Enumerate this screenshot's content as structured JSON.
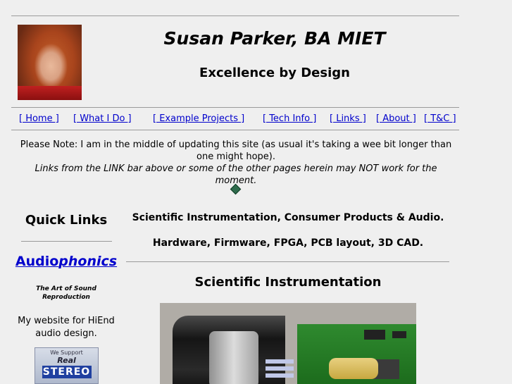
{
  "header": {
    "name": "Susan Parker, BA MIET",
    "tagline": "Excellence by Design"
  },
  "nav": {
    "home": "[ Home ]",
    "what_i_do": "[ What I Do ]",
    "example_projects": "[ Example Projects ]",
    "tech_info": "[ Tech Info ]",
    "links": "[ Links ]",
    "about": "[ About ]",
    "tc": "[ T&C ]"
  },
  "notice": {
    "line1": "Please Note: I am in the middle of updating this site (as usual it's taking a wee bit longer than one might hope).",
    "line2": "Links from the LINK bar above or some of the other pages herein may NOT work for the moment."
  },
  "sidebar": {
    "title": "Quick Links",
    "audio_prefix": "Audio",
    "audio_suffix": "phonics",
    "audio_tagline": "The Art of Sound Reproduction",
    "description": "My website for HiEnd audio design.",
    "badge": {
      "line1": "We Support",
      "line2": "Real",
      "line3": "STEREO"
    }
  },
  "main": {
    "heading1": "Scientific Instrumentation, Consumer Products & Audio.",
    "heading2": "Hardware, Firmware, FPGA, PCB layout, 3D CAD.",
    "section_title": "Scientific Instrumentation"
  }
}
